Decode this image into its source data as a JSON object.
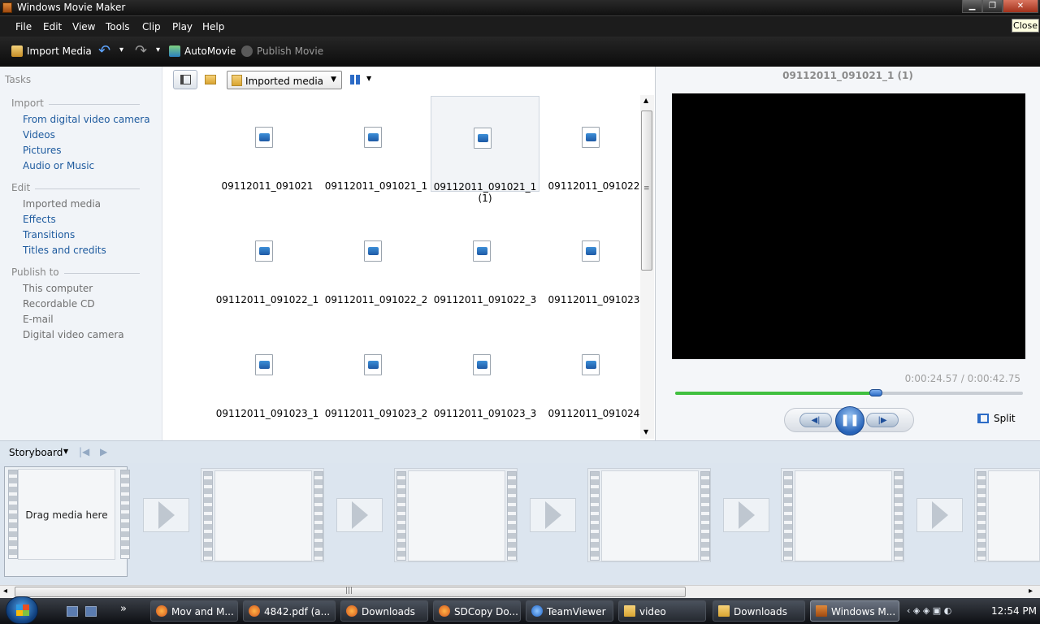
{
  "window": {
    "title": "Windows Movie Maker",
    "close_tooltip": "Close",
    "min_glyph": "▁",
    "max_glyph": "❐",
    "close_glyph": "✕"
  },
  "menu": [
    "File",
    "Edit",
    "View",
    "Tools",
    "Clip",
    "Play",
    "Help"
  ],
  "toolbar": {
    "import": "Import Media",
    "automovie": "AutoMovie",
    "publish": "Publish Movie",
    "undo_glyph": "↶",
    "redo_glyph": "↷",
    "dropdown_glyph": "▾"
  },
  "tasks": {
    "header": "Tasks",
    "import": {
      "title": "Import",
      "links": [
        "From digital video camera",
        "Videos",
        "Pictures",
        "Audio or Music"
      ]
    },
    "edit": {
      "title": "Edit",
      "links": [
        "Imported media",
        "Effects",
        "Transitions",
        "Titles and credits"
      ]
    },
    "publish": {
      "title": "Publish to",
      "links": [
        "This computer",
        "Recordable CD",
        "E-mail",
        "Digital video camera"
      ]
    }
  },
  "content": {
    "collection": "Imported media",
    "dropdown_glyph": "▼",
    "items": [
      "09112011_091021",
      "09112011_091021_1",
      "09112011_091021_1 (1)",
      "09112011_091022",
      "09112011_091022_1",
      "09112011_091022_2",
      "09112011_091022_3",
      "09112011_091023",
      "09112011_091023_1",
      "09112011_091023_2",
      "09112011_091023_3",
      "09112011_091024"
    ],
    "selected_index": 2,
    "scroll_up": "▲",
    "scroll_down": "▼",
    "scroll_grip": "≡"
  },
  "preview": {
    "title": "09112011_091021_1 (1)",
    "timecode": "0:00:24.57 / 0:00:42.75",
    "progress": 0.576,
    "prev_glyph": "◀|",
    "pause_glyph": "❚❚",
    "next_glyph": "|▶",
    "split": "Split"
  },
  "storyboard": {
    "label": "Storyboard",
    "dropdown_glyph": "▼",
    "back_glyph": "|◀",
    "play_glyph": "▶",
    "drag_text": "Drag media here"
  },
  "scrollbar": {
    "left": "◂",
    "right": "▸",
    "grip": "|||"
  },
  "taskbar": {
    "tasks": [
      "Mov and M...",
      "4842.pdf (a...",
      "Downloads",
      "SDCopy Do...",
      "TeamViewer",
      "video",
      "Downloads",
      "Windows M..."
    ],
    "more": "»",
    "tray_glyphs": "‹  ◈ ◈  ▣ ◐",
    "time": "12:54 PM"
  },
  "colors": {
    "accent": "#2c6bc6",
    "link": "#1d5a9e",
    "progress": "#40c040"
  }
}
